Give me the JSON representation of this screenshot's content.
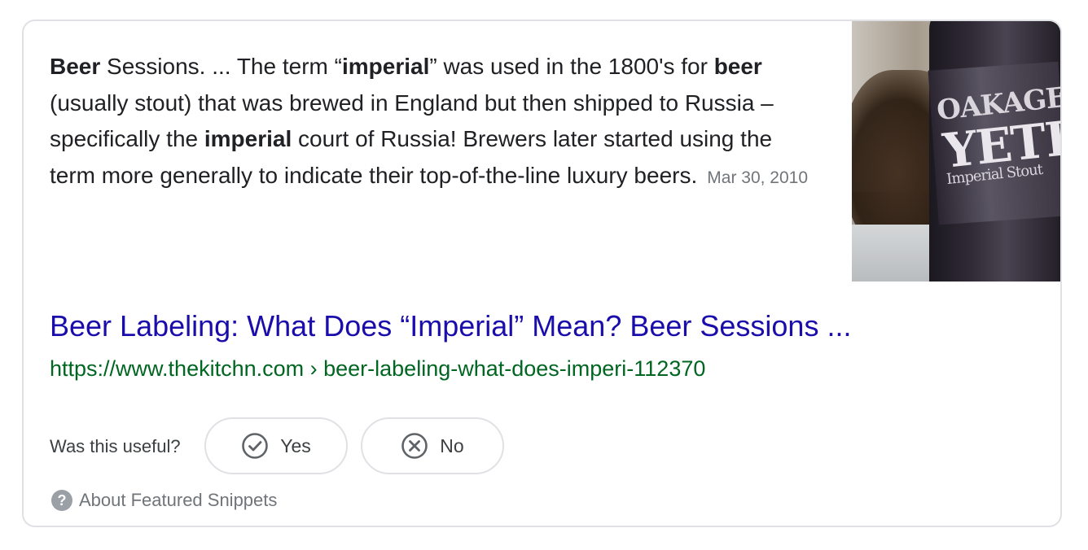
{
  "snippet": {
    "s1": "Beer",
    "s2": " Sessions. ... The term “",
    "s3": "imperial",
    "s4": "” was used in the 1800's for ",
    "s5": "beer",
    "s6": " (usually stout) that was brewed in England but then shipped to Russia – specifically the ",
    "s7": "imperial",
    "s8": " court of Russia! Brewers later started using the term more generally to indicate their top-of-the-line luxury beers.",
    "date": "Mar 30, 2010"
  },
  "thumbnail": {
    "label_line1": "OAKAGE",
    "label_line2": "YETI",
    "label_line3": "Imperial Stout"
  },
  "result": {
    "title": "Beer Labeling: What Does “Imperial” Mean? Beer Sessions ...",
    "url": "https://www.thekitchn.com › beer-labeling-what-does-imperi-112370"
  },
  "feedback": {
    "question": "Was this useful?",
    "yes_label": "Yes",
    "no_label": "No",
    "yes_icon": "check-circle-icon",
    "no_icon": "x-circle-icon"
  },
  "about": {
    "label": "About Featured Snippets",
    "icon": "help-circle-icon"
  },
  "colors": {
    "link": "#1a0dab",
    "url": "#006621",
    "text": "#202124",
    "muted": "#70757a",
    "border": "#dfe1e5"
  }
}
